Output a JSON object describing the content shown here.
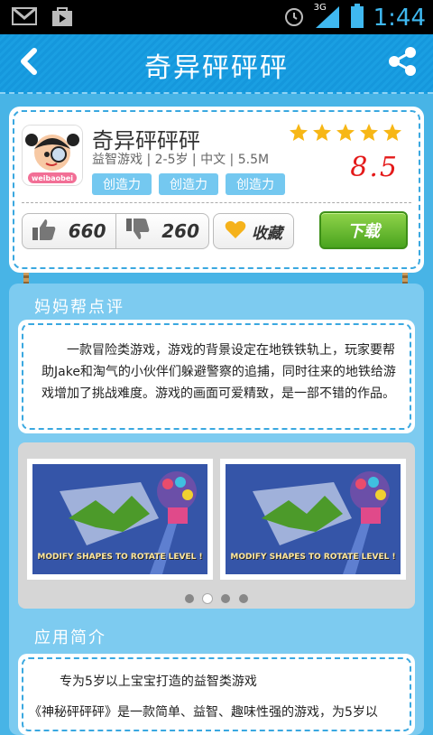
{
  "status_bar": {
    "time": "1:44",
    "network": "3G",
    "icons": [
      "gmail-icon",
      "store-icon",
      "alarm-icon",
      "signal-icon",
      "battery-icon"
    ]
  },
  "header": {
    "title": "奇异砰砰砰",
    "back_icon": "back-arrow-icon",
    "share_icon": "share-icon"
  },
  "app": {
    "name": "奇异砰砰砰",
    "meta": "益智游戏 | 2-5岁 |  中文  |  5.5M",
    "tags": [
      "创造力",
      "创造力",
      "创造力"
    ],
    "rating_stars": 5,
    "score": "8.5",
    "icon_text": "weibaobei",
    "likes": "660",
    "dislikes": "260",
    "favorite_label": "收藏",
    "download_label": "下载"
  },
  "review": {
    "title": "妈妈帮点评",
    "text": "一款冒险类游戏，游戏的背景设定在地铁铁轨上，玩家要帮助Jake和淘气的小伙伴们躲避警察的追捕，同时往来的地铁给游戏增加了挑战难度。游戏的画面可爱精致，是一部不错的作品。"
  },
  "gallery": {
    "screenshots": [
      {
        "caption": "MODIFY SHAPES TO ROTATE LEVEL !"
      },
      {
        "caption": "MODIFY SHAPES TO ROTATE LEVEL !"
      }
    ],
    "page_count": 4,
    "active_page": 2
  },
  "intro": {
    "title": "应用简介",
    "line1": "专为5岁以上宝宝打造的益智类游戏",
    "line2": "《神秘砰砰砰》是一款简单、益智、趣味性强的游戏，为5岁以"
  },
  "colors": {
    "header_bg": "#1a9fe2",
    "page_bg": "#48b4e6",
    "score_red": "#e41a1a",
    "download_green": "#4aa41e",
    "tag_blue": "#74c8f0"
  }
}
